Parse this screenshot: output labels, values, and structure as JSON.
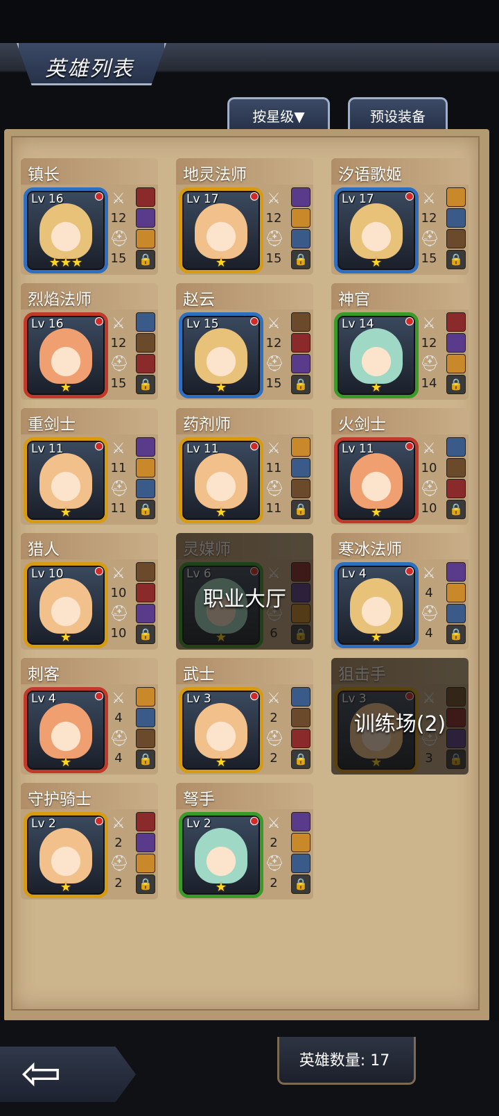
{
  "header": {
    "title": "英雄列表",
    "sort_label": "按星级▼",
    "preset_label": "预设装备"
  },
  "footer": {
    "hero_count": "英雄数量: 17"
  },
  "colors": {
    "frame_blue": "#2f6fc0",
    "frame_red": "#c0392b",
    "frame_gold": "#d79b12",
    "frame_green": "#3a9a2a",
    "star": "#ffd52a"
  },
  "heroes": [
    {
      "name": "镇长",
      "level": "Lv 16",
      "stars": "★★★",
      "attack": "12",
      "defense": "15",
      "frame": "blue"
    },
    {
      "name": "地灵法师",
      "level": "Lv 17",
      "stars": "★",
      "attack": "12",
      "defense": "15",
      "frame": "gold"
    },
    {
      "name": "汐语歌姬",
      "level": "Lv 17",
      "stars": "★",
      "attack": "12",
      "defense": "15",
      "frame": "blue"
    },
    {
      "name": "烈焰法师",
      "level": "Lv 16",
      "stars": "★",
      "attack": "12",
      "defense": "15",
      "frame": "red"
    },
    {
      "name": "赵云",
      "level": "Lv 15",
      "stars": "★",
      "attack": "12",
      "defense": "15",
      "frame": "blue"
    },
    {
      "name": "神官",
      "level": "Lv 14",
      "stars": "★",
      "attack": "12",
      "defense": "14",
      "frame": "green"
    },
    {
      "name": "重剑士",
      "level": "Lv 11",
      "stars": "★",
      "attack": "11",
      "defense": "11",
      "frame": "gold"
    },
    {
      "name": "药剂师",
      "level": "Lv 11",
      "stars": "★",
      "attack": "11",
      "defense": "11",
      "frame": "gold"
    },
    {
      "name": "火剑士",
      "level": "Lv 11",
      "stars": "★",
      "attack": "10",
      "defense": "10",
      "frame": "red"
    },
    {
      "name": "猎人",
      "level": "Lv 10",
      "stars": "★",
      "attack": "10",
      "defense": "10",
      "frame": "gold"
    },
    {
      "name": "灵媒师",
      "level": "Lv 6",
      "stars": "★",
      "attack": "",
      "defense": "6",
      "frame": "green",
      "overlay": "职业大厅"
    },
    {
      "name": "寒冰法师",
      "level": "Lv 4",
      "stars": "★",
      "attack": "4",
      "defense": "4",
      "frame": "blue"
    },
    {
      "name": "刺客",
      "level": "Lv 4",
      "stars": "★",
      "attack": "4",
      "defense": "4",
      "frame": "red"
    },
    {
      "name": "武士",
      "level": "Lv 3",
      "stars": "★",
      "attack": "2",
      "defense": "2",
      "frame": "gold"
    },
    {
      "name": "狙击手",
      "level": "Lv 3",
      "stars": "★",
      "attack": "",
      "defense": "3",
      "frame": "gold",
      "overlay": "训练场(2)"
    },
    {
      "name": "守护骑士",
      "level": "Lv 2",
      "stars": "★",
      "attack": "2",
      "defense": "2",
      "frame": "gold"
    },
    {
      "name": "弩手",
      "level": "Lv 2",
      "stars": "★",
      "attack": "2",
      "defense": "2",
      "frame": "green"
    }
  ]
}
